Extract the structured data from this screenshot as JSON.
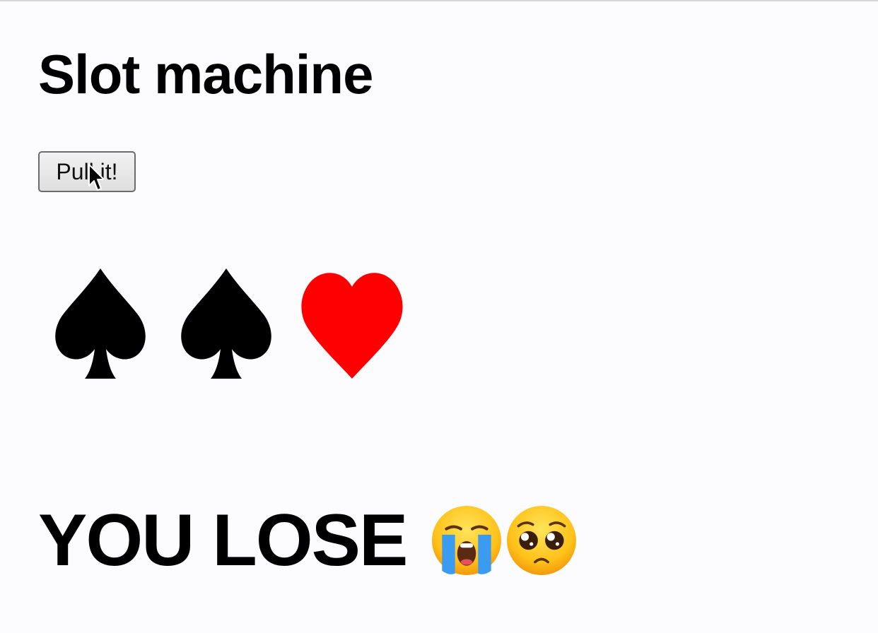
{
  "title": "Slot machine",
  "button": {
    "label": "Pull it!"
  },
  "reels": [
    {
      "symbol": "spade",
      "color": "#000000"
    },
    {
      "symbol": "spade",
      "color": "#000000"
    },
    {
      "symbol": "heart",
      "color": "#ff0000"
    }
  ],
  "result": {
    "text": "YOU LOSE",
    "emojis": [
      "loudly-crying-face-icon",
      "pleading-face-icon"
    ]
  },
  "colors": {
    "background": "#fcfcff",
    "text": "#000000",
    "heart": "#ff0000"
  }
}
